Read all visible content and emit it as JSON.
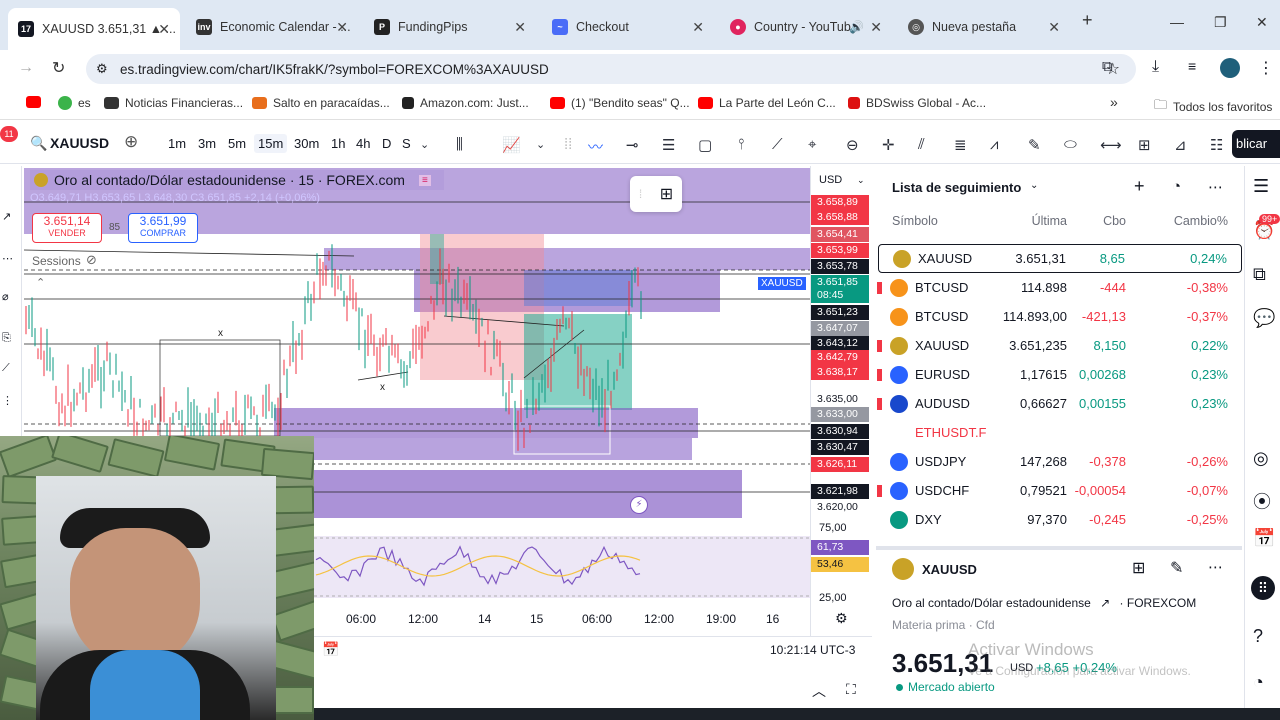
{
  "browser": {
    "tabs": [
      {
        "title": "XAUUSD 3.651,31 ▲ ...",
        "active": true
      },
      {
        "title": "Economic Calendar - ..."
      },
      {
        "title": "FundingPips"
      },
      {
        "title": "Checkout"
      },
      {
        "title": "Country - YouTub"
      },
      {
        "title": "Nueva pestaña"
      }
    ],
    "url": "es.tradingview.com/chart/IK5frakK/?symbol=FOREXCOM%3AXAUUSD",
    "bookmarks": [
      "es",
      "Noticias Financieras...",
      "Salto en paracaídas...",
      "Amazon.com: Just...",
      "(1) \"Bendito seas\" Q...",
      "La Parte del León C...",
      "BDSwiss Global - Ac..."
    ],
    "all_bookmarks": "Todos los favoritos",
    "notif_count": "11"
  },
  "toolbar": {
    "symbol": "XAUUSD",
    "timeframes": [
      "1m",
      "3m",
      "5m",
      "15m",
      "30m",
      "1h",
      "4h",
      "D",
      "S"
    ],
    "selected_timeframe": "15m",
    "publish": "blicar"
  },
  "chart": {
    "title": "Oro al contado/Dólar estadounidense · 15 · FOREX.com",
    "ohlc": "O3.649,71 H3.653,65 L3.648,30 C3.651,85 +2,14 (+0,06%)",
    "sell_price": "3.651,14",
    "sell_label": "VENDER",
    "spread": "85",
    "buy_price": "3.651,99",
    "buy_label": "COMPRAR",
    "sessions": "Sessions",
    "currency": "USD",
    "symbol_tag": "XAUUSD",
    "time_labels": [
      "06:00",
      "12:00",
      "14",
      "15",
      "06:00",
      "12:00",
      "19:00",
      "16"
    ],
    "clock": "10:21:14 UTC-3",
    "rsi_levels": [
      "75,00",
      "25,00"
    ],
    "rsi_values": [
      "61,73",
      "53,46"
    ]
  },
  "price_labels": [
    {
      "v": "3.658,89",
      "c": "#f23645"
    },
    {
      "v": "3.658,88",
      "c": "#f23645"
    },
    {
      "v": "3.654,41",
      "c": "#e05561"
    },
    {
      "v": "3.653,99",
      "c": "#f23645"
    },
    {
      "v": "3.653,78",
      "c": "#131722"
    },
    {
      "v": "3.651,85",
      "c": "#089981"
    },
    {
      "v": "08:45",
      "c": "#089981"
    },
    {
      "v": "3.651,23",
      "c": "#131722"
    },
    {
      "v": "3.647,07",
      "c": "#9598a1"
    },
    {
      "v": "3.643,12",
      "c": "#131722"
    },
    {
      "v": "3.642,79",
      "c": "#f23645"
    },
    {
      "v": "3.638,17",
      "c": "#f23645"
    },
    {
      "v": "3.635,00",
      "c": "none"
    },
    {
      "v": "3.633,00",
      "c": "#9598a1"
    },
    {
      "v": "3.630,94",
      "c": "#131722"
    },
    {
      "v": "3.630,47",
      "c": "#131722"
    },
    {
      "v": "3.626,11",
      "c": "#f23645"
    },
    {
      "v": "3.621,98",
      "c": "#131722"
    },
    {
      "v": "3.620,00",
      "c": "none"
    }
  ],
  "watchlist": {
    "title": "Lista de seguimiento",
    "headers": {
      "symbol": "Símbolo",
      "last": "Última",
      "chg": "Cbo",
      "pct": "Cambio%"
    },
    "rows": [
      {
        "sym": "XAUUSD",
        "last": "3.651,31",
        "chg": "8,65",
        "pct": "0,24%",
        "dir": "up",
        "icon": "#c9a227",
        "flag": false,
        "selected": true
      },
      {
        "sym": "BTCUSD",
        "last": "114.898",
        "chg": "-444",
        "pct": "-0,38%",
        "dir": "down",
        "icon": "#f7931a",
        "flag": true
      },
      {
        "sym": "BTCUSD",
        "last": "114.893,00",
        "chg": "-421,13",
        "pct": "-0,37%",
        "dir": "down",
        "icon": "#f7931a",
        "flag": false
      },
      {
        "sym": "XAUUSD",
        "last": "3.651,235",
        "chg": "8,150",
        "pct": "0,22%",
        "dir": "up",
        "icon": "#c9a227",
        "flag": true
      },
      {
        "sym": "EURUSD",
        "last": "1,17615",
        "chg": "0,00268",
        "pct": "0,23%",
        "dir": "up",
        "icon": "#2962ff",
        "flag": true
      },
      {
        "sym": "AUDUSD",
        "last": "0,66627",
        "chg": "0,00155",
        "pct": "0,23%",
        "dir": "up",
        "icon": "#1848cc",
        "flag": true
      },
      {
        "sym": "ETHUSDT.F",
        "last": "",
        "chg": "",
        "pct": "",
        "dir": "none",
        "icon": "",
        "flag": false
      },
      {
        "sym": "USDJPY",
        "last": "147,268",
        "chg": "-0,378",
        "pct": "-0,26%",
        "dir": "down",
        "icon": "#2962ff",
        "flag": false
      },
      {
        "sym": "USDCHF",
        "last": "0,79521",
        "chg": "-0,00054",
        "pct": "-0,07%",
        "dir": "down",
        "icon": "#2962ff",
        "flag": true
      },
      {
        "sym": "DXY",
        "last": "97,370",
        "chg": "-0,245",
        "pct": "-0,25%",
        "dir": "down",
        "icon": "#089981",
        "flag": false
      }
    ]
  },
  "detail": {
    "symbol": "XAUUSD",
    "name": "Oro al contado/Dólar estadounidense",
    "exchange": "FOREXCOM",
    "type": "Materia prima · Cfd",
    "price": "3.651,31",
    "currency": "USD",
    "change": "+8,65 +0,24%",
    "status": "Mercado abierto",
    "activate_windows": "Activar Windows",
    "activate_hint": "Ve a Configuración para activar Windows."
  }
}
